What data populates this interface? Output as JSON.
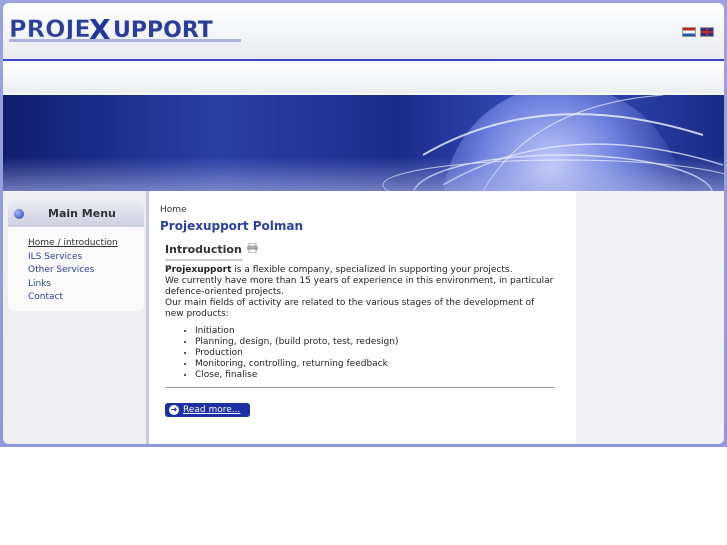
{
  "header": {
    "logo_text": "ProjeXupport",
    "languages": [
      "Nederlands",
      "English"
    ]
  },
  "menu": {
    "title": "Main Menu",
    "items": [
      {
        "label": "Home / introduction",
        "active": true
      },
      {
        "label": "ILS Services"
      },
      {
        "label": "Other Services"
      },
      {
        "label": "Links"
      },
      {
        "label": "Contact"
      }
    ]
  },
  "main": {
    "breadcrumb": "Home",
    "page_title": "Projexupport Polman",
    "article": {
      "title": "Introduction",
      "company": "Projexupport",
      "line1_rest": " is a flexible company, specialized in supporting your projects.",
      "line2": "We currently have more than 15 years of experience in this environment, in particular defence-oriented projects.",
      "line3": "Our main fields of activity are related to the various stages of the development of new products:",
      "bullets": [
        "Initiation",
        "Planning, design, (build proto, test, redesign)",
        "Production",
        "Monitoring, controlling, returning feedback",
        "Close, finalise"
      ],
      "read_more": "Read more..."
    }
  },
  "colors": {
    "accent": "#2b3fa0",
    "frame": "#9aa3e0",
    "button": "#1c2fa3"
  },
  "icons": [
    "print-icon",
    "menu-bullet-icon",
    "read-more-arrow-icon",
    "flag-nl-icon",
    "flag-en-icon"
  ]
}
